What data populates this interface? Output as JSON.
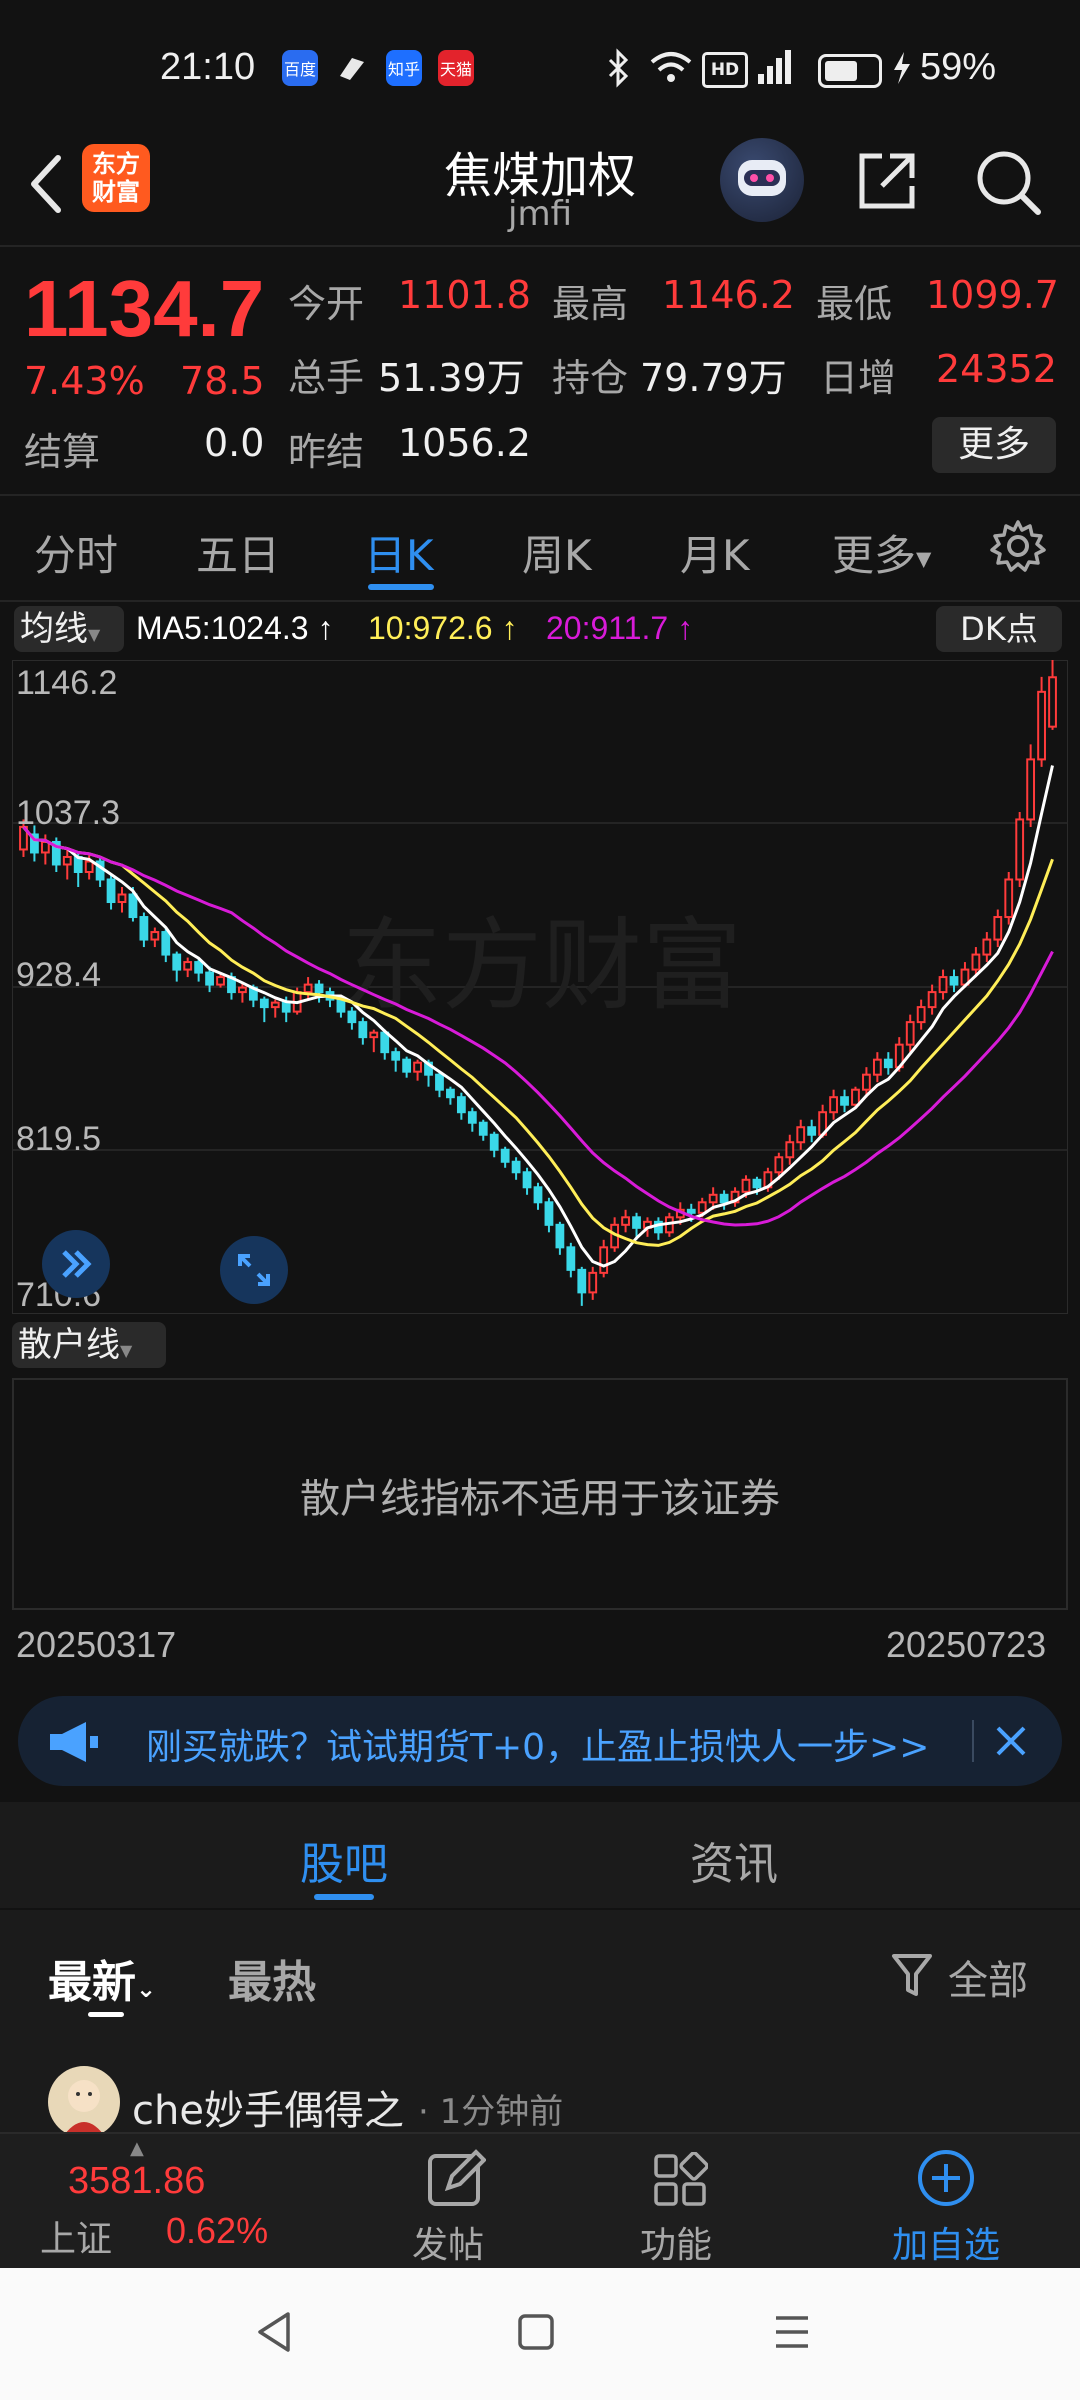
{
  "status_bar": {
    "time": "21:10",
    "battery": "59%",
    "apps": [
      "百度",
      "知乎",
      "天猫"
    ]
  },
  "header": {
    "title": "焦煤加权",
    "code": "jmfi",
    "logo_text": "东方财富"
  },
  "quote": {
    "price": "1134.7",
    "change_pct": "7.43%",
    "change": "78.5",
    "open_label": "今开",
    "open": "1101.8",
    "high_label": "最高",
    "high": "1146.2",
    "low_label": "最低",
    "low": "1099.7",
    "volume_label": "总手",
    "volume": "51.39万",
    "oi_label": "持仓",
    "oi": "79.79万",
    "daily_inc_label": "日增",
    "daily_inc": "24352",
    "settle_label": "结算",
    "settle": "0.0",
    "prev_settle_label": "昨结",
    "prev_settle": "1056.2",
    "more_button": "更多"
  },
  "tabs": [
    "分时",
    "五日",
    "日K",
    "周K",
    "月K",
    "更多"
  ],
  "active_tab": "日K",
  "indicator": {
    "selector": "均线",
    "ma5": "MA5:1024.3",
    "ma10": "10:972.6",
    "ma20": "20:911.7",
    "dk_button": "DK点"
  },
  "colors": {
    "up": "#ff3b3b",
    "down": "#3ad8e8",
    "ma5": "#ffffff",
    "ma10": "#ffee58",
    "ma20": "#d81bd8",
    "accent": "#2f8ff0"
  },
  "chart_data": {
    "type": "candlestick",
    "y_ticks": [
      "1146.2",
      "1037.3",
      "928.4",
      "819.5",
      "710.6"
    ],
    "ylim": [
      710.6,
      1146.2
    ],
    "x_start": "20250317",
    "x_end": "20250723",
    "watermark": "东方财富",
    "candles": [
      [
        1020,
        1035,
        1015,
        1040
      ],
      [
        1030,
        1018,
        1012,
        1036
      ],
      [
        1018,
        1025,
        1010,
        1030
      ],
      [
        1025,
        1010,
        1005,
        1028
      ],
      [
        1010,
        1015,
        1000,
        1020
      ],
      [
        1015,
        1005,
        995,
        1018
      ],
      [
        1005,
        1012,
        1000,
        1016
      ],
      [
        1012,
        1000,
        995,
        1015
      ],
      [
        1000,
        985,
        980,
        1003
      ],
      [
        985,
        990,
        978,
        995
      ],
      [
        990,
        975,
        972,
        995
      ],
      [
        975,
        960,
        955,
        978
      ],
      [
        960,
        965,
        955,
        968
      ],
      [
        965,
        950,
        945,
        968
      ],
      [
        950,
        940,
        932,
        952
      ],
      [
        940,
        945,
        935,
        948
      ],
      [
        945,
        938,
        932,
        948
      ],
      [
        938,
        930,
        925,
        942
      ],
      [
        930,
        935,
        928,
        938
      ],
      [
        935,
        925,
        920,
        938
      ],
      [
        925,
        928,
        918,
        932
      ],
      [
        928,
        920,
        915,
        930
      ],
      [
        920,
        915,
        905,
        922
      ],
      [
        915,
        918,
        908,
        920
      ],
      [
        918,
        912,
        905,
        922
      ],
      [
        912,
        925,
        910,
        928
      ],
      [
        925,
        930,
        920,
        935
      ],
      [
        930,
        925,
        918,
        933
      ],
      [
        925,
        920,
        915,
        928
      ],
      [
        920,
        912,
        908,
        922
      ],
      [
        912,
        905,
        900,
        915
      ],
      [
        905,
        895,
        890,
        908
      ],
      [
        895,
        898,
        885,
        900
      ],
      [
        898,
        885,
        880,
        900
      ],
      [
        885,
        880,
        872,
        888
      ],
      [
        880,
        872,
        868,
        882
      ],
      [
        872,
        878,
        866,
        880
      ],
      [
        878,
        870,
        862,
        880
      ],
      [
        870,
        860,
        855,
        872
      ],
      [
        860,
        855,
        850,
        862
      ],
      [
        855,
        845,
        840,
        858
      ],
      [
        845,
        838,
        832,
        848
      ],
      [
        838,
        830,
        826,
        840
      ],
      [
        830,
        820,
        815,
        832
      ],
      [
        820,
        812,
        808,
        822
      ],
      [
        812,
        805,
        800,
        815
      ],
      [
        805,
        795,
        790,
        808
      ],
      [
        795,
        785,
        780,
        798
      ],
      [
        785,
        770,
        765,
        788
      ],
      [
        770,
        755,
        750,
        772
      ],
      [
        755,
        740,
        735,
        758
      ],
      [
        740,
        725,
        716,
        742
      ],
      [
        725,
        738,
        720,
        742
      ],
      [
        738,
        755,
        735,
        760
      ],
      [
        755,
        770,
        752,
        775
      ],
      [
        770,
        775,
        765,
        780
      ],
      [
        775,
        768,
        760,
        778
      ],
      [
        768,
        772,
        762,
        775
      ],
      [
        772,
        765,
        760,
        775
      ],
      [
        765,
        775,
        762,
        778
      ],
      [
        775,
        780,
        770,
        785
      ],
      [
        780,
        778,
        772,
        784
      ],
      [
        778,
        785,
        775,
        788
      ],
      [
        785,
        790,
        780,
        795
      ],
      [
        790,
        785,
        780,
        793
      ],
      [
        785,
        792,
        782,
        795
      ],
      [
        792,
        800,
        788,
        803
      ],
      [
        800,
        795,
        790,
        802
      ],
      [
        795,
        805,
        792,
        808
      ],
      [
        805,
        815,
        800,
        818
      ],
      [
        815,
        825,
        810,
        830
      ],
      [
        825,
        835,
        820,
        840
      ],
      [
        835,
        830,
        825,
        840
      ],
      [
        830,
        845,
        828,
        850
      ],
      [
        845,
        855,
        840,
        860
      ],
      [
        855,
        850,
        845,
        860
      ],
      [
        850,
        860,
        848,
        862
      ],
      [
        860,
        870,
        855,
        875
      ],
      [
        870,
        880,
        865,
        885
      ],
      [
        880,
        875,
        870,
        885
      ],
      [
        875,
        890,
        872,
        895
      ],
      [
        890,
        905,
        885,
        910
      ],
      [
        905,
        915,
        900,
        920
      ],
      [
        915,
        925,
        910,
        930
      ],
      [
        925,
        935,
        920,
        940
      ],
      [
        935,
        930,
        925,
        940
      ],
      [
        930,
        940,
        928,
        945
      ],
      [
        940,
        950,
        935,
        955
      ],
      [
        950,
        960,
        945,
        965
      ],
      [
        960,
        975,
        955,
        980
      ],
      [
        975,
        1000,
        970,
        1005
      ],
      [
        1000,
        1040,
        995,
        1045
      ],
      [
        1040,
        1080,
        1035,
        1090
      ],
      [
        1080,
        1125,
        1075,
        1135
      ],
      [
        1101.8,
        1134.7,
        1099.7,
        1146.2
      ]
    ]
  },
  "retail_line": {
    "selector": "散户线",
    "message": "散户线指标不适用于该证券"
  },
  "banner": {
    "text": "刚买就跌？试试期货T+0，止盈止损快人一步>>"
  },
  "section_tabs": [
    "股吧",
    "资讯"
  ],
  "active_section": "股吧",
  "filters": {
    "latest": "最新",
    "hottest": "最热",
    "all": "全部"
  },
  "post": {
    "author": "che妙手偶得之",
    "time": "· 1分钟前"
  },
  "bottom_nav": {
    "index_value": "3581.86",
    "index_name": "上证",
    "index_change": "0.62%",
    "items": [
      "发帖",
      "功能",
      "加自选"
    ]
  }
}
